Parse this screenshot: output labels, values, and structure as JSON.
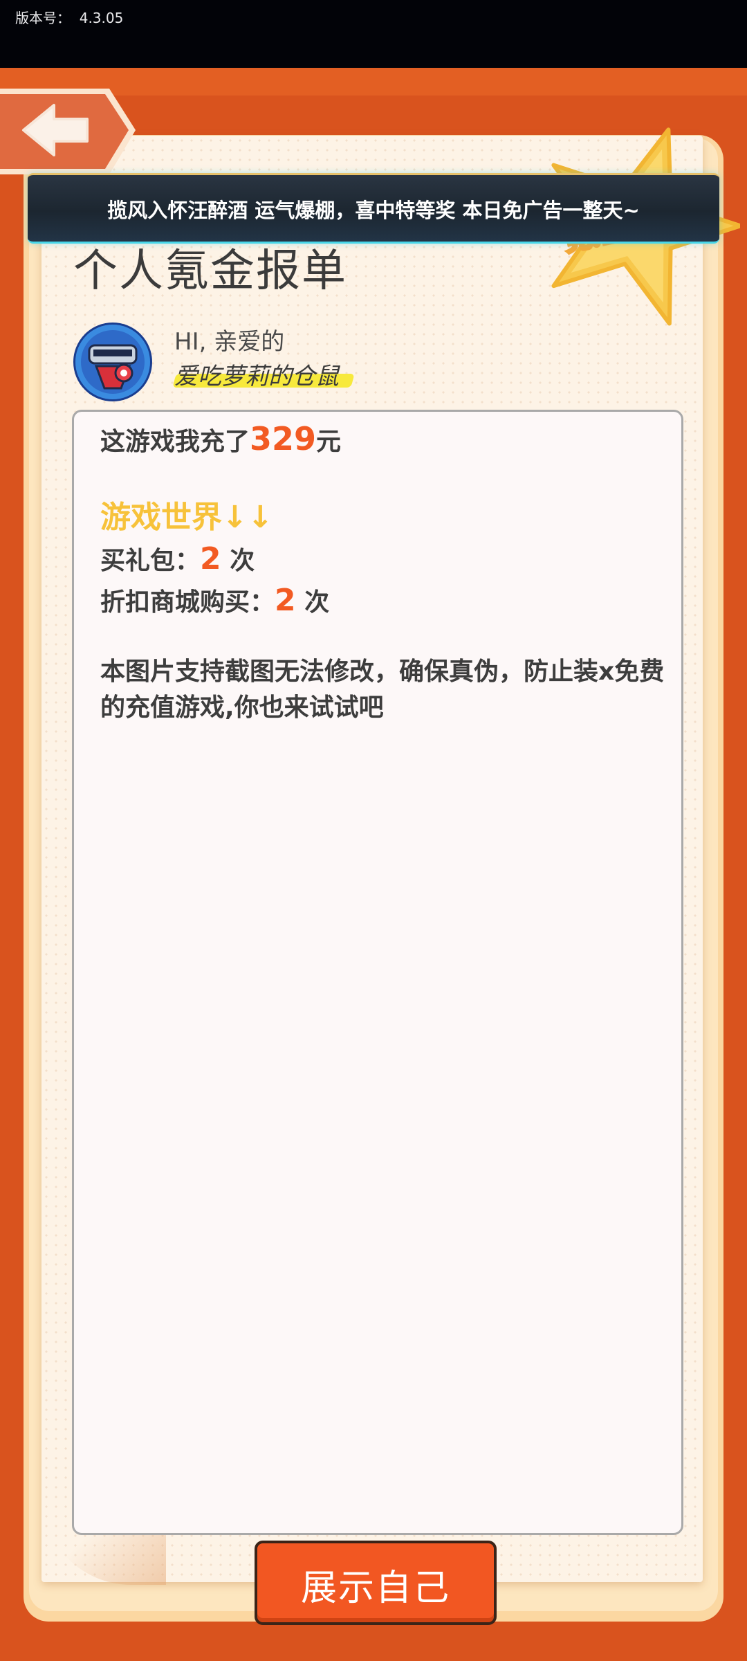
{
  "header": {
    "version_label": "版本号：",
    "version_value": "4.3.05"
  },
  "banner": {
    "text": "揽风入怀汪醉酒 运气爆棚，喜中特等奖 本日免广告一整天~"
  },
  "badge": {
    "text": "氪金之王"
  },
  "report": {
    "title": "个人氪金报单",
    "greeting": "HI, 亲爱的",
    "nickname": "爱吃萝莉的仓鼠",
    "recharge_prefix": "这游戏我充了",
    "recharge_amount": "329",
    "recharge_suffix": "元",
    "section_title": "游戏世界↓↓",
    "gift_label": "买礼包：",
    "gift_count": "2",
    "gift_unit": "次",
    "shop_label": "折扣商城购买：",
    "shop_count": "2",
    "shop_unit": "次",
    "description": "本图片支持截图无法修改，确保真伪，防止装x免费的充值游戏,你也来试试吧"
  },
  "actions": {
    "show_button": "展示自己"
  },
  "colors": {
    "background": "#d9531e",
    "accent": "#f25a22",
    "highlight": "#f7c23a"
  }
}
